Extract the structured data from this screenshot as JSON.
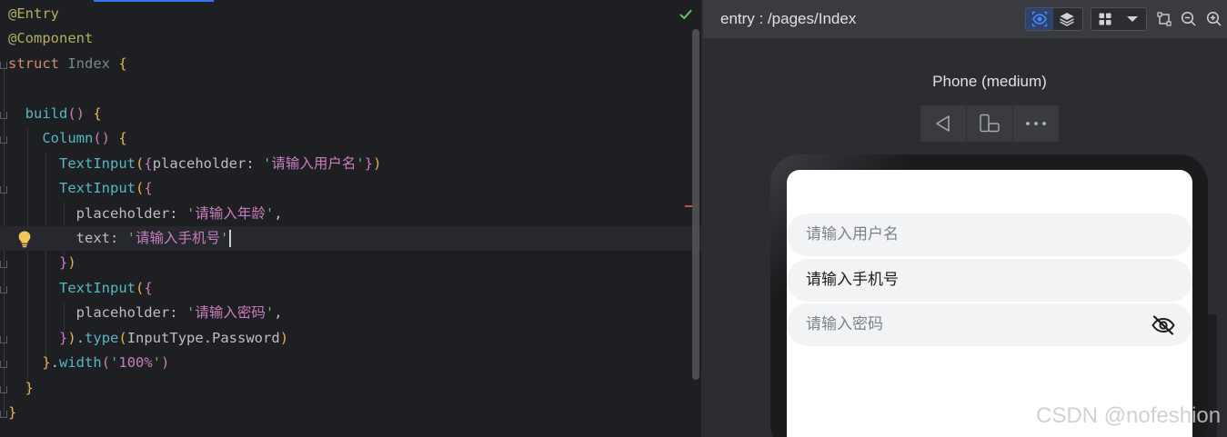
{
  "editor": {
    "lines": [
      {
        "tokens": [
          [
            "tk-ann",
            "@Entry"
          ]
        ]
      },
      {
        "tokens": [
          [
            "tk-ann",
            "@Component"
          ]
        ]
      },
      {
        "tokens": [
          [
            "tk-kw",
            "struct "
          ],
          [
            "tk-cls",
            "Index "
          ],
          [
            "tk-brk1",
            "{"
          ]
        ]
      },
      {
        "tokens": []
      },
      {
        "tokens": [
          [
            "",
            "  "
          ],
          [
            "tk-comp",
            "build"
          ],
          [
            "tk-brk2",
            "()"
          ],
          [
            "tk-prop",
            " "
          ],
          [
            "tk-brk1",
            "{"
          ]
        ]
      },
      {
        "tokens": [
          [
            "",
            "    "
          ],
          [
            "tk-comp",
            "Column"
          ],
          [
            "tk-brk2",
            "()"
          ],
          [
            "tk-prop",
            " "
          ],
          [
            "tk-brk1",
            "{"
          ]
        ]
      },
      {
        "tokens": [
          [
            "",
            "      "
          ],
          [
            "tk-comp",
            "TextInput"
          ],
          [
            "tk-brk1",
            "("
          ],
          [
            "tk-brk2",
            "{"
          ],
          [
            "tk-prop",
            "placeholder: "
          ],
          [
            "tk-str",
            "'"
          ],
          [
            "tk-strc",
            "请输入用户名"
          ],
          [
            "tk-str",
            "'"
          ],
          [
            "tk-brk2",
            "}"
          ],
          [
            "tk-brk1",
            ")"
          ]
        ]
      },
      {
        "tokens": [
          [
            "",
            "      "
          ],
          [
            "tk-comp",
            "TextInput"
          ],
          [
            "tk-brk1",
            "("
          ],
          [
            "tk-brk2",
            "{"
          ]
        ]
      },
      {
        "tokens": [
          [
            "",
            "        "
          ],
          [
            "tk-prop",
            "placeholder: "
          ],
          [
            "tk-str",
            "'"
          ],
          [
            "tk-strc",
            "请输入年龄"
          ],
          [
            "tk-str",
            "'"
          ],
          [
            "tk-prop",
            ","
          ]
        ]
      },
      {
        "current": true,
        "caret": true,
        "tokens": [
          [
            "",
            "        "
          ],
          [
            "tk-prop",
            "text: "
          ],
          [
            "tk-str",
            "'"
          ],
          [
            "tk-strc",
            "请输入手机号"
          ],
          [
            "tk-str",
            "'"
          ]
        ]
      },
      {
        "tokens": [
          [
            "",
            "      "
          ],
          [
            "tk-brk2",
            "}"
          ],
          [
            "tk-brk1",
            ")"
          ]
        ]
      },
      {
        "tokens": [
          [
            "",
            "      "
          ],
          [
            "tk-comp",
            "TextInput"
          ],
          [
            "tk-brk1",
            "("
          ],
          [
            "tk-brk2",
            "{"
          ]
        ]
      },
      {
        "tokens": [
          [
            "",
            "        "
          ],
          [
            "tk-prop",
            "placeholder: "
          ],
          [
            "tk-str",
            "'"
          ],
          [
            "tk-strc",
            "请输入密码"
          ],
          [
            "tk-str",
            "'"
          ],
          [
            "tk-prop",
            ","
          ]
        ]
      },
      {
        "tokens": [
          [
            "",
            "      "
          ],
          [
            "tk-brk2",
            "}"
          ],
          [
            "tk-brk1",
            ")"
          ],
          [
            "tk-prop",
            "."
          ],
          [
            "tk-comp",
            "type"
          ],
          [
            "tk-brk1",
            "("
          ],
          [
            "tk-prop",
            "InputType.Password"
          ],
          [
            "tk-brk1",
            ")"
          ]
        ]
      },
      {
        "tokens": [
          [
            "",
            "    "
          ],
          [
            "tk-brk1",
            "}"
          ],
          [
            "tk-prop",
            "."
          ],
          [
            "tk-comp",
            "width"
          ],
          [
            "tk-brk2",
            "("
          ],
          [
            "tk-str",
            "'"
          ],
          [
            "tk-strc",
            "100%"
          ],
          [
            "tk-str",
            "'"
          ],
          [
            "tk-brk2",
            ")"
          ]
        ]
      },
      {
        "tokens": [
          [
            "",
            "  "
          ],
          [
            "tk-brk1",
            "}"
          ]
        ]
      },
      {
        "tokens": [
          [
            "tk-brk1",
            "}"
          ]
        ]
      }
    ]
  },
  "preview": {
    "title": "entry : /pages/Index",
    "device_label": "Phone (medium)",
    "inputs": [
      {
        "text": "请输入用户名",
        "state": "placeholder"
      },
      {
        "text": "请输入手机号",
        "state": "value"
      },
      {
        "text": "请输入密码",
        "state": "placeholder",
        "password": true
      }
    ]
  },
  "colors": {
    "accent": "#3574f0",
    "editor_bg": "#1e1f22",
    "preview_bg": "#2b2d30"
  },
  "icons": [
    "check-icon",
    "lightbulb-icon",
    "inspector-icon",
    "layers-icon",
    "grid-icon",
    "chevron-down-icon",
    "crop-icon",
    "zoom-out-icon",
    "zoom-in-icon",
    "back-icon",
    "rotate-device-icon",
    "more-icon",
    "eye-off-icon"
  ],
  "watermark": "CSDN @nofeshion"
}
